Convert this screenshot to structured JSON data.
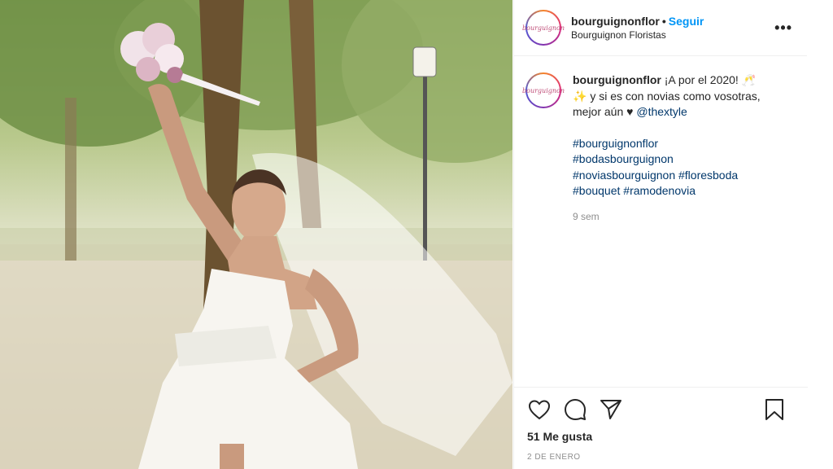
{
  "post": {
    "username": "bourguignonflor",
    "follow_label": "Seguir",
    "dot": "•",
    "location": "Bourguignon Floristas",
    "more_label": "•••",
    "avatar_text": "bourguignon",
    "caption": {
      "username": "bourguignonflor",
      "text_line1": "¡A por el 2020! 🥂",
      "text_line2": "✨ y si es con novias como vosotras,",
      "text_line3_prefix": "mejor aún ♥",
      "mention": "@thextyle",
      "hashtags_line1": "#bourguignonflor",
      "hashtags_line2": "#bodasbourguignon",
      "hashtags_line3a": "#noviasbourguignon",
      "hashtags_line3b": "#floresboda",
      "hashtags_line4a": "#bouquet",
      "hashtags_line4b": "#ramodenovia",
      "time_ago": "9 sem"
    },
    "likes": "51 Me gusta",
    "date": "2 de enero",
    "icons": {
      "like": "heart-icon",
      "comment": "comment-icon",
      "share": "paper-plane-icon",
      "save": "bookmark-icon"
    }
  }
}
